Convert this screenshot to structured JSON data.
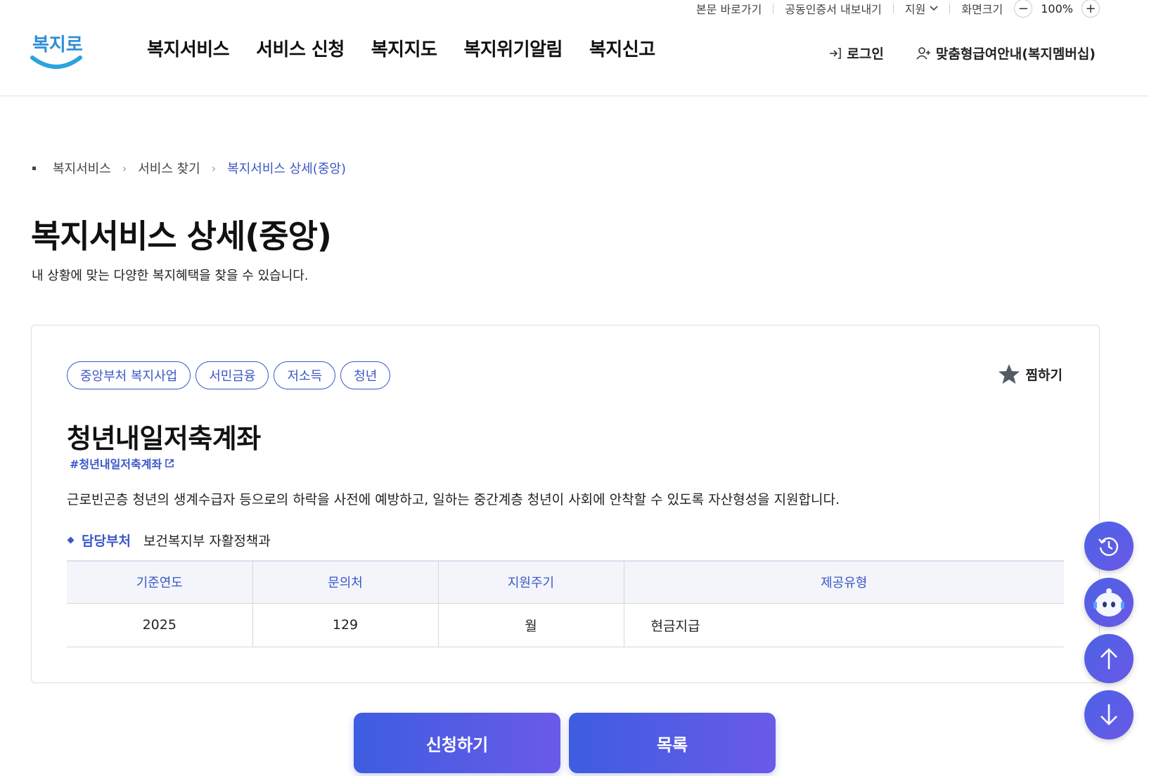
{
  "util": {
    "skip": "본문 바로가기",
    "cert": "공동인증서 내보내기",
    "region": "지원",
    "zoom_label": "화면크기",
    "zoom_value": "100%",
    "zoom_out": "−",
    "zoom_in": "+"
  },
  "header": {
    "logo_text": "복지로",
    "gnb": [
      "복지서비스",
      "서비스 신청",
      "복지지도",
      "복지위기알림",
      "복지신고"
    ],
    "login": "로그인",
    "membership": "맞춤형급여안내(복지멤버십)"
  },
  "breadcrumb": [
    "복지서비스",
    "서비스 찾기",
    "복지서비스 상세(중앙)"
  ],
  "page": {
    "title": "복지서비스 상세(중앙)",
    "desc": "내 상황에 맞는 다양한 복지혜택을 찾을 수 있습니다."
  },
  "card": {
    "tags": [
      "중앙부처 복지사업",
      "서민금융",
      "저소득",
      "청년"
    ],
    "favorite": "찜하기",
    "title": "청년내일저축계좌",
    "hashtag": "#청년내일저축계좌",
    "description": "근로빈곤층 청년의 생계수급자 등으로의 하락을 사전에 예방하고, 일하는 중간계층 청년이 사회에 안착할 수 있도록 자산형성을 지원합니다.",
    "dept_label": "담당부처",
    "dept_value": "보건복지부 자활정책과",
    "table": {
      "headers": [
        "기준연도",
        "문의처",
        "지원주기",
        "제공유형"
      ],
      "row": [
        "2025",
        "129",
        "월",
        "현금지급"
      ]
    }
  },
  "buttons": {
    "apply": "신청하기",
    "list": "목록"
  },
  "colors": {
    "accent": "#3a56c7",
    "button_gradient_start": "#3d5de0",
    "button_gradient_end": "#6a5ae8"
  }
}
